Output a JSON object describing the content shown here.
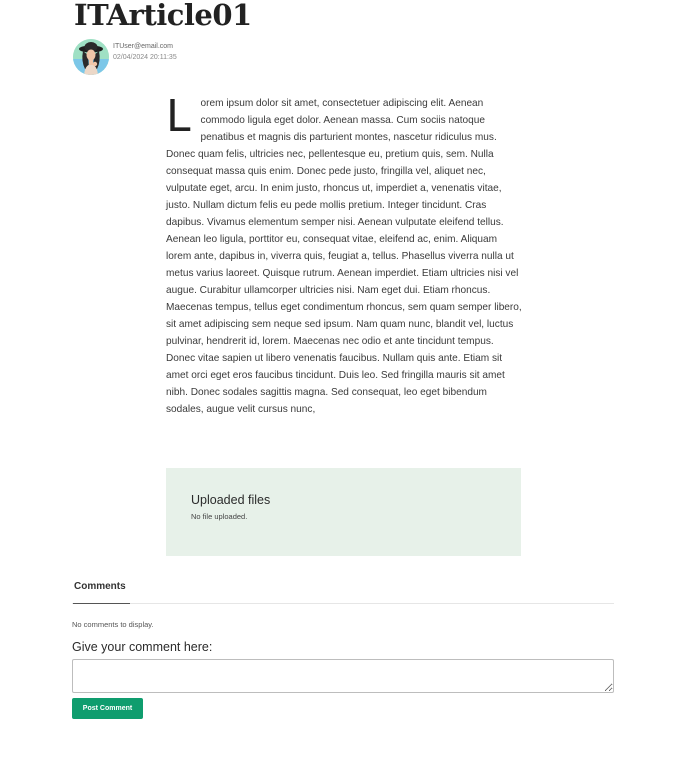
{
  "article": {
    "title": "ITArticle01",
    "author_email": "ITUser@email.com",
    "date": "02/04/2024 20:11:35",
    "drop_cap": "L",
    "body": "orem ipsum dolor sit amet, consectetuer adipiscing elit. Aenean commodo ligula eget dolor. Aenean massa. Cum sociis natoque penatibus et magnis dis parturient montes, nascetur ridiculus mus. Donec quam felis, ultricies nec, pellentesque eu, pretium quis, sem. Nulla consequat massa quis enim. Donec pede justo, fringilla vel, aliquet nec, vulputate eget, arcu. In enim justo, rhoncus ut, imperdiet a, venenatis vitae, justo. Nullam dictum felis eu pede mollis pretium. Integer tincidunt. Cras dapibus. Vivamus elementum semper nisi. Aenean vulputate eleifend tellus. Aenean leo ligula, porttitor eu, consequat vitae, eleifend ac, enim. Aliquam lorem ante, dapibus in, viverra quis, feugiat a, tellus. Phasellus viverra nulla ut metus varius laoreet. Quisque rutrum. Aenean imperdiet. Etiam ultricies nisi vel augue. Curabitur ullamcorper ultricies nisi. Nam eget dui. Etiam rhoncus. Maecenas tempus, tellus eget condimentum rhoncus, sem quam semper libero, sit amet adipiscing sem neque sed ipsum. Nam quam nunc, blandit vel, luctus pulvinar, hendrerit id, lorem. Maecenas nec odio et ante tincidunt tempus. Donec vitae sapien ut libero venenatis faucibus. Nullam quis ante. Etiam sit amet orci eget eros faucibus tincidunt. Duis leo. Sed fringilla mauris sit amet nibh. Donec sodales sagittis magna. Sed consequat, leo eget bibendum sodales, augue velit cursus nunc,"
  },
  "uploads": {
    "title": "Uploaded files",
    "empty_message": "No file uploaded.",
    "background_color": "#e7f1e9"
  },
  "comments": {
    "tab_label": "Comments",
    "empty_message": "No comments to display.",
    "input_label": "Give your comment here:",
    "input_value": "",
    "post_button_label": "Post Comment",
    "button_color": "#0f9d6e"
  },
  "icons": {
    "avatar": "user-avatar-photo"
  }
}
